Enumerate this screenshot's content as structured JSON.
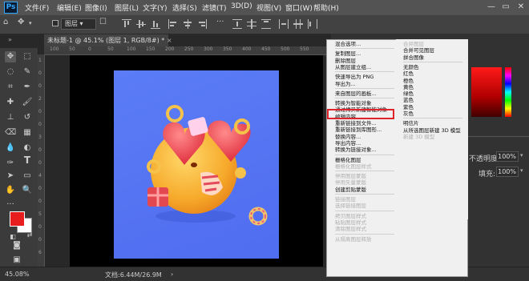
{
  "app": {
    "logo": "Ps"
  },
  "menu": [
    "文件(F)",
    "编辑(E)",
    "图像(I)",
    "图层(L)",
    "文字(Y)",
    "选择(S)",
    "滤镜(T)",
    "3D(D)",
    "视图(V)",
    "窗口(W)",
    "帮助(H)"
  ],
  "options": {
    "layer_select": "图层"
  },
  "tab": {
    "title": "未标题-1 @ 45.1% (图层 1, RGB/8#) *",
    "close": "×"
  },
  "ruler_h": [
    "100",
    "50",
    "0",
    "50",
    "100",
    "150",
    "200",
    "250",
    "300",
    "350",
    "400",
    "450",
    "500",
    "550"
  ],
  "ruler_v": [
    "1",
    "0",
    "0",
    "2",
    "0",
    "0",
    "3",
    "0",
    "0",
    "4",
    "0",
    "0",
    "5",
    "0",
    "0",
    "6"
  ],
  "status": {
    "zoom": "45.08%",
    "doc": "文档:6.44M/26.9M"
  },
  "panel": {
    "opacity_label": "不透明度:",
    "opacity_value": "100%",
    "fill_label": "填充:",
    "fill_value": "100%"
  },
  "context_menu": {
    "col1": [
      {
        "t": "混合选项...",
        "dis": false
      },
      {
        "t": "",
        "sep": true
      },
      {
        "t": "复制图层...",
        "dis": false
      },
      {
        "t": "删除图层",
        "dis": false
      },
      {
        "t": "从图层建立组...",
        "dis": false
      },
      {
        "t": "",
        "sep": true
      },
      {
        "t": "快速导出为 PNG",
        "dis": false
      },
      {
        "t": "导出为...",
        "dis": false
      },
      {
        "t": "",
        "sep": true
      },
      {
        "t": "来自图层的画板...",
        "dis": false
      },
      {
        "t": "",
        "sep": true
      },
      {
        "t": "转换为智能对象",
        "dis": false
      },
      {
        "t": "通过拷贝新建智能对象",
        "dis": false
      },
      {
        "t": "编辑内容",
        "dis": false
      },
      {
        "t": "重新链接到文件...",
        "dis": false
      },
      {
        "t": "重新链接到库图形...",
        "dis": false
      },
      {
        "t": "替换内容...",
        "dis": false
      },
      {
        "t": "导出内容...",
        "dis": false
      },
      {
        "t": "转换为链接对象...",
        "dis": false
      },
      {
        "t": "",
        "sep": true
      },
      {
        "t": "栅格化图层",
        "dis": false
      },
      {
        "t": "栅格化图层样式",
        "dis": true
      },
      {
        "t": "",
        "sep": true
      },
      {
        "t": "停用图层蒙版",
        "dis": true
      },
      {
        "t": "停用矢量蒙版",
        "dis": true
      },
      {
        "t": "创建剪贴蒙版",
        "dis": false
      },
      {
        "t": "",
        "sep": true
      },
      {
        "t": "链接图层",
        "dis": true
      },
      {
        "t": "选择链接图层",
        "dis": true
      },
      {
        "t": "",
        "sep": true
      },
      {
        "t": "拷贝图层样式",
        "dis": true
      },
      {
        "t": "粘贴图层样式",
        "dis": true
      },
      {
        "t": "清除图层样式",
        "dis": true
      },
      {
        "t": "",
        "sep": true
      },
      {
        "t": "从隔离图层释放",
        "dis": true
      }
    ],
    "col2": [
      {
        "t": "合并图层",
        "dis": true
      },
      {
        "t": "合并可见图层",
        "dis": false
      },
      {
        "t": "拼合图像",
        "dis": false
      },
      {
        "t": "",
        "sep": true
      },
      {
        "t": "无颜色",
        "dis": false
      },
      {
        "t": "红色",
        "dis": false
      },
      {
        "t": "橙色",
        "dis": false
      },
      {
        "t": "黄色",
        "dis": false
      },
      {
        "t": "绿色",
        "dis": false
      },
      {
        "t": "蓝色",
        "dis": false
      },
      {
        "t": "紫色",
        "dis": false
      },
      {
        "t": "灰色",
        "dis": false
      },
      {
        "t": "",
        "sep": true
      },
      {
        "t": "明信片",
        "dis": false
      },
      {
        "t": "从所选图层新建 3D 模型",
        "dis": false
      },
      {
        "t": "新建 3D 模型",
        "dis": true
      }
    ]
  },
  "colors": {
    "accent": "#e0242c",
    "foreground": "#e81e1e",
    "background": "#ffffff"
  }
}
